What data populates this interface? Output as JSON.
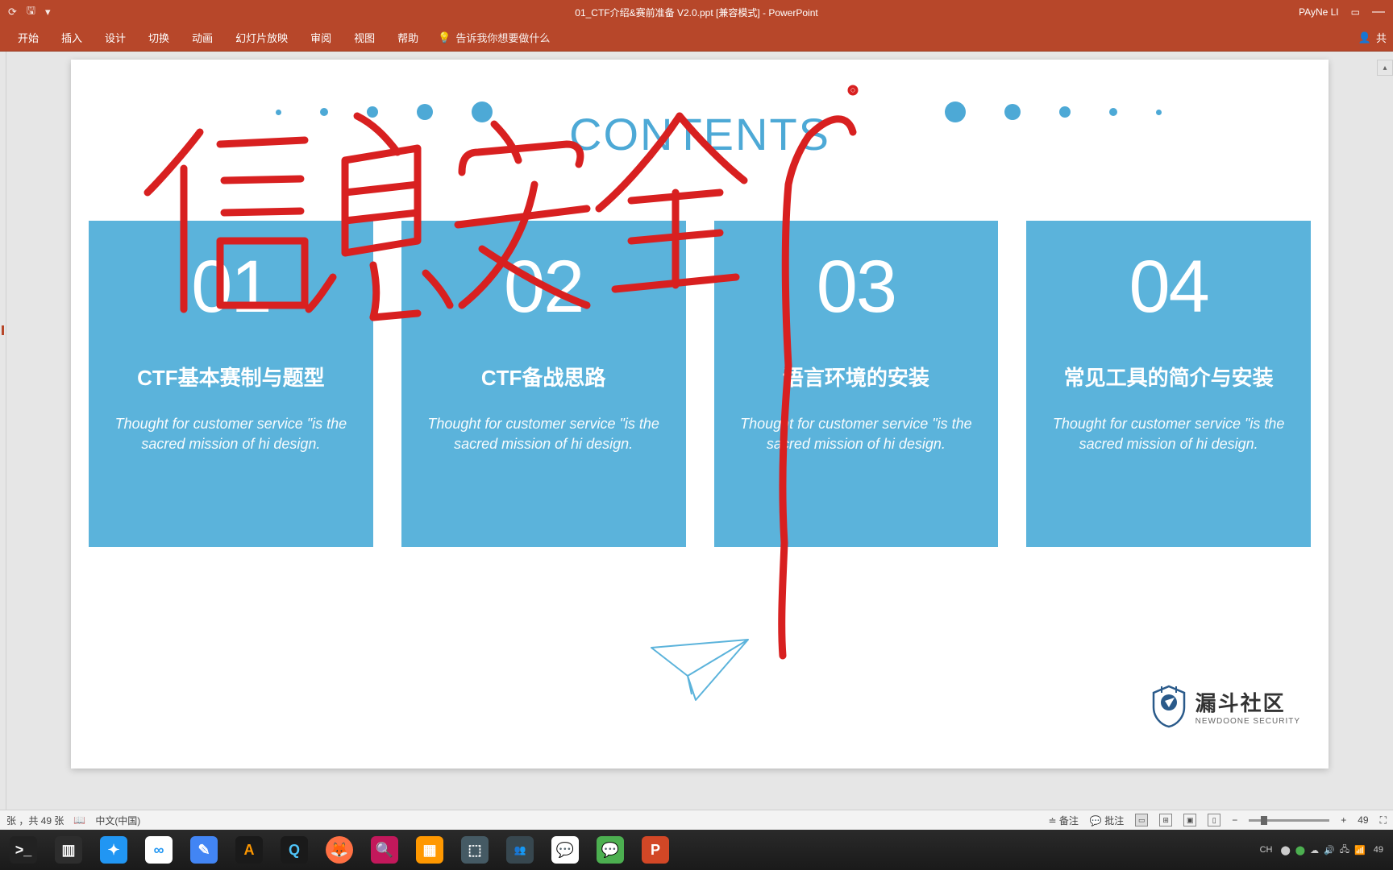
{
  "titlebar": {
    "filename": "01_CTF介绍&赛前准备 V2.0.ppt [兼容模式]  -  PowerPoint",
    "user": "PAyNe LI"
  },
  "ribbon": {
    "tabs": [
      "开始",
      "插入",
      "设计",
      "切换",
      "动画",
      "幻灯片放映",
      "审阅",
      "视图",
      "帮助"
    ],
    "tell_me": "告诉我你想要做什么",
    "share": "共"
  },
  "slide": {
    "contents_heading": "CONTENTS",
    "cards": [
      {
        "num": "01",
        "title": "CTF基本赛制与题型",
        "desc": "Thought for customer service \"is the sacred mission of hi design."
      },
      {
        "num": "02",
        "title": "CTF备战思路",
        "desc": "Thought for customer service \"is the sacred mission of hi design."
      },
      {
        "num": "03",
        "title": "语言环境的安装",
        "desc": "Thought for customer service \"is the sacred mission of hi design."
      },
      {
        "num": "04",
        "title": "常见工具的简介与安装",
        "desc": "Thought for customer service \"is the sacred mission of hi design."
      }
    ],
    "logo": {
      "cn": "漏斗社区",
      "en": "NEWDOONE SECURITY"
    }
  },
  "status": {
    "slide_count": "张 ，共 49 张",
    "language": "中文(中国)",
    "notes": "备注",
    "comments": "批注",
    "zoom": "49"
  },
  "taskbar": {
    "ime": "CH",
    "signal": "49"
  }
}
